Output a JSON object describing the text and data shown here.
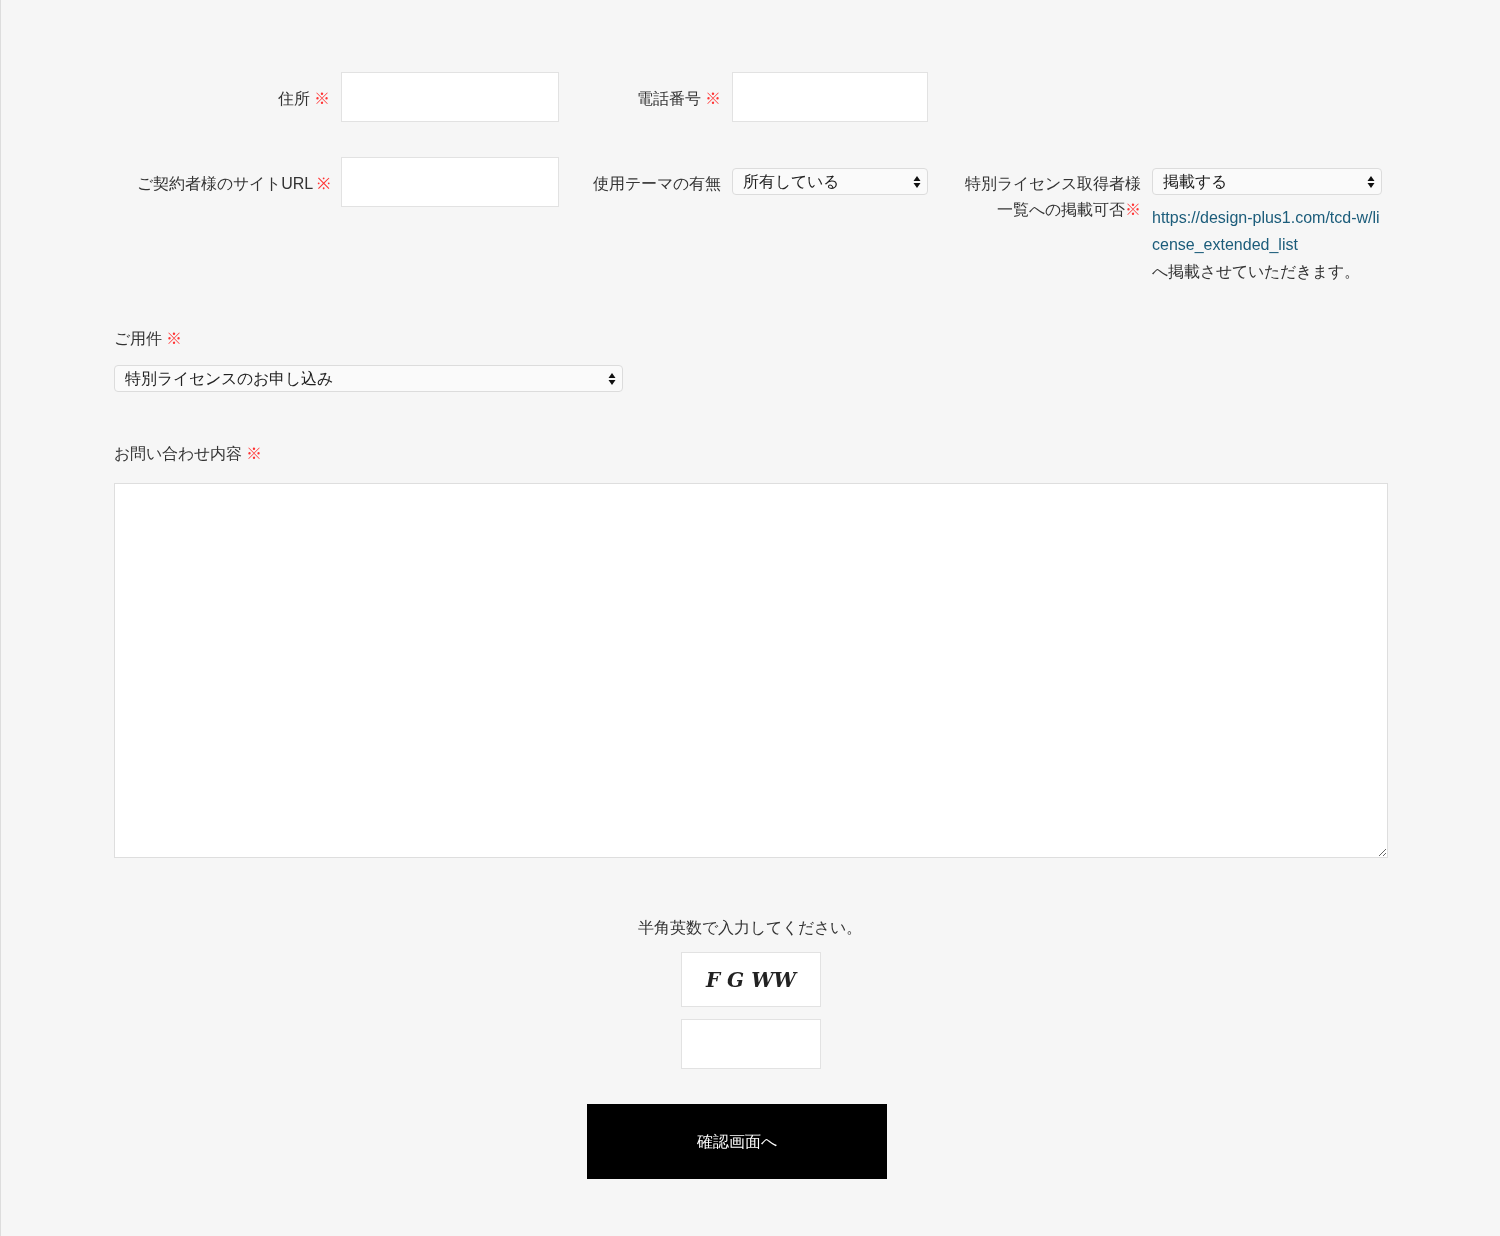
{
  "required_mark": "※",
  "row_1": [
    {
      "kind": "input",
      "label": "住所",
      "required": true
    },
    {
      "kind": "input",
      "label": "電話番号",
      "required": true
    }
  ],
  "row_2": [
    {
      "kind": "input",
      "label": "ご契約者様のサイトURL",
      "required": true
    },
    {
      "kind": "select",
      "label": "使用テーマの有無",
      "required": false,
      "value": "所有している"
    },
    {
      "kind": "select",
      "label": "特別ライセンス取得者様一覧への掲載可否",
      "required": true,
      "value": "掲載する",
      "note_link": "https://design-plus1.com/tcd-w/license_extended_list",
      "note_text": "へ掲載させていただきます。"
    }
  ],
  "purpose": {
    "label": "ご用件",
    "required": true,
    "value": "特別ライセンスのお申し込み"
  },
  "message": {
    "label": "お問い合わせ内容",
    "required": true
  },
  "captcha": {
    "prompt": "半角英数で入力してください。",
    "code": "F G WW"
  },
  "submit_button": "確認画面へ"
}
